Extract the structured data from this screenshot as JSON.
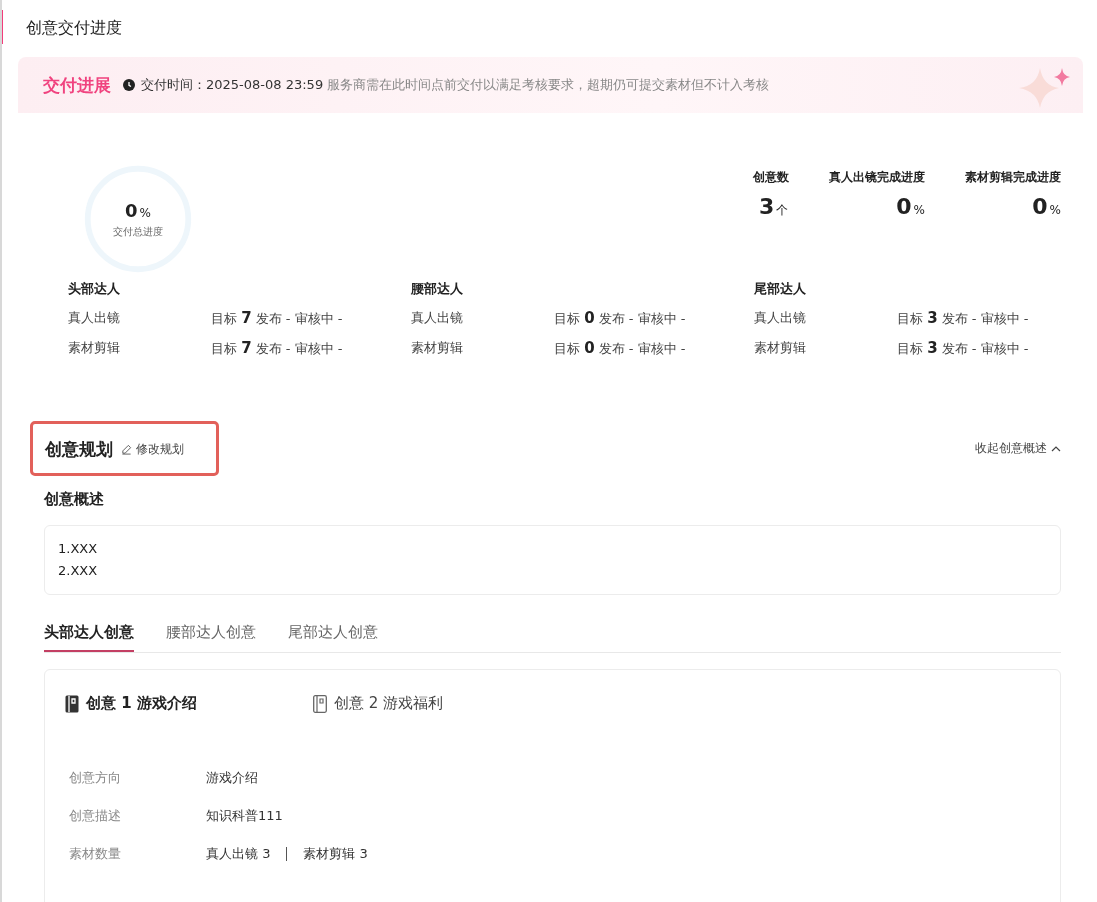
{
  "page_title": "创意交付进度",
  "banner": {
    "title": "交付进展",
    "deadline": "交付时间：2025-08-08 23:59",
    "note": "服务商需在此时间点前交付以满足考核要求，超期仍可提交素材但不计入考核"
  },
  "overall": {
    "value": "0",
    "unit": "%",
    "label": "交付总进度",
    "level": 0
  },
  "stats": [
    {
      "label": "创意数",
      "value": "3",
      "unit": "个"
    },
    {
      "label": "真人出镜完成进度",
      "value": "0",
      "unit": "%"
    },
    {
      "label": "素材剪辑完成进度",
      "value": "0",
      "unit": "%"
    }
  ],
  "talent_groups": [
    {
      "title": "头部达人",
      "rows": [
        {
          "label": "真人出镜",
          "value": "目标 **7** 发布 - 审核中 -"
        },
        {
          "label": "素材剪辑",
          "value": "目标 **7** 发布 - 审核中 -"
        }
      ]
    },
    {
      "title": "腰部达人",
      "rows": [
        {
          "label": "真人出镜",
          "value": "目标 **0** 发布 - 审核中 -"
        },
        {
          "label": "素材剪辑",
          "value": "目标 **0** 发布 - 审核中 -"
        }
      ]
    },
    {
      "title": "尾部达人",
      "rows": [
        {
          "label": "真人出镜",
          "value": "目标 **3** 发布 - 审核中 -"
        },
        {
          "label": "素材剪辑",
          "value": "目标 **3** 发布 - 审核中 -"
        }
      ]
    }
  ],
  "plan": {
    "title": "创意规划",
    "edit_link": "修改规划",
    "collapse_link": "收起创意概述",
    "highlighted": true
  },
  "overview": {
    "title": "创意概述",
    "lines": [
      "1.XXX",
      "2.XXX"
    ]
  },
  "tabs": [
    {
      "label": "头部达人创意",
      "selected": true
    },
    {
      "label": "腰部达人创意",
      "selected": false
    },
    {
      "label": "尾部达人创意",
      "selected": false
    }
  ],
  "creatives": [
    {
      "label": "创意 1 游戏介绍",
      "selected": true
    },
    {
      "label": "创意 2 游戏福利",
      "selected": false
    }
  ],
  "details": [
    {
      "label": "创意方向",
      "values": [
        "游戏介绍"
      ]
    },
    {
      "label": "创意描述",
      "values": [
        "知识科普111"
      ]
    },
    {
      "label": "素材数量",
      "values": [
        "真人出镜 3",
        "素材剪辑 3"
      ]
    }
  ]
}
